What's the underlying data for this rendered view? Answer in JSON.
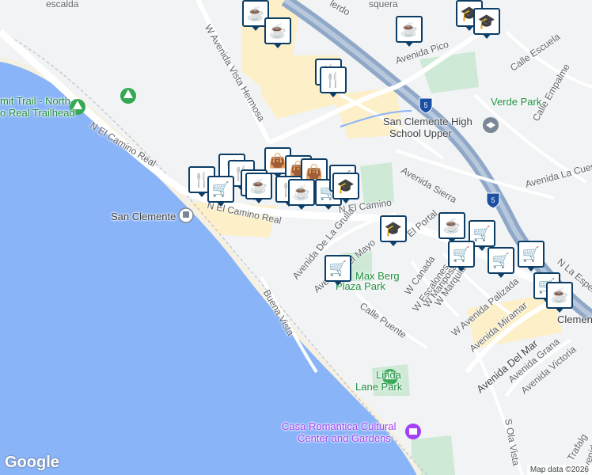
{
  "map": {
    "colors": {
      "land": "#f1f3f4",
      "water": "#8ab4f8",
      "park": "#ceead6",
      "highway": "#8fa8c8",
      "road": "#ffffff",
      "commercial": "#fdf0c8"
    },
    "labels": [
      {
        "id": "n-el-camino-real-1",
        "text": "N El Camino Real",
        "kind": "road"
      },
      {
        "id": "n-el-camino-real-2",
        "text": "N El Camino Real",
        "kind": "road"
      },
      {
        "id": "n-el-camino-real-3",
        "text": "N El Camino",
        "kind": "road"
      },
      {
        "id": "w-avenida-vista-hermosa",
        "text": "W Avenida Vista Hermosa",
        "kind": "road"
      },
      {
        "id": "avenida-pico",
        "text": "Avenida Pico",
        "kind": "road"
      },
      {
        "id": "calle-escuela",
        "text": "Calle Escuela",
        "kind": "road"
      },
      {
        "id": "calle-empalme",
        "text": "Calle Empalme",
        "kind": "road"
      },
      {
        "id": "avenida-sierra",
        "text": "Avenida Sierra",
        "kind": "road"
      },
      {
        "id": "avenida-la-cuesta",
        "text": "Avenida La Cuesta",
        "kind": "road"
      },
      {
        "id": "avenida-de-la-grulla",
        "text": "Avenida De La Grulla",
        "kind": "road"
      },
      {
        "id": "el-portal",
        "text": "El Portal",
        "kind": "road"
      },
      {
        "id": "avenida-del-mayo",
        "text": "Avenida Del Mayo",
        "kind": "road"
      },
      {
        "id": "w-canada",
        "text": "W Canada",
        "kind": "road"
      },
      {
        "id": "w-escalones",
        "text": "W Escalones",
        "kind": "road"
      },
      {
        "id": "w-mariposa",
        "text": "W Mariposa",
        "kind": "road"
      },
      {
        "id": "w-marquita",
        "text": "W Marquita",
        "kind": "road"
      },
      {
        "id": "w-avenida-palizada",
        "text": "W Avenida Palizada",
        "kind": "road"
      },
      {
        "id": "avenida-miramar",
        "text": "Avenida Miramar",
        "kind": "road"
      },
      {
        "id": "n-la-esperanza",
        "text": "N La Espera",
        "kind": "road"
      },
      {
        "id": "calle-puente",
        "text": "Calle Puente",
        "kind": "road"
      },
      {
        "id": "buena-vista",
        "text": "Buena Vista",
        "kind": "road"
      },
      {
        "id": "avenida-del-mar",
        "text": "Avenida Del Mar",
        "kind": "road"
      },
      {
        "id": "avenida-granada",
        "text": "Avenida Grana",
        "kind": "road"
      },
      {
        "id": "avenida-victoria",
        "text": "Avenida Victoria",
        "kind": "road"
      },
      {
        "id": "s-ola-vista",
        "text": "S Ola Vista",
        "kind": "road"
      },
      {
        "id": "trafalgar",
        "text": "Trafalg",
        "kind": "road"
      },
      {
        "id": "avenida-la-paz",
        "text": "Avenida La",
        "kind": "road"
      },
      {
        "id": "w-escalda",
        "text": "escalda",
        "kind": "road"
      },
      {
        "id": "esquera",
        "text": "squera",
        "kind": "road"
      },
      {
        "id": "top-calle",
        "text": "lerdo",
        "kind": "road"
      },
      {
        "id": "san-clemente-station",
        "text": "San Clemente",
        "kind": "poi"
      },
      {
        "id": "san-clemente-high",
        "text": "San Clemente High",
        "kind": "poi"
      },
      {
        "id": "san-clemente-high-2",
        "text": "School Upper",
        "kind": "poi"
      },
      {
        "id": "verde-park",
        "text": "Verde Park",
        "kind": "park"
      },
      {
        "id": "max-berg",
        "text": "Max Berg",
        "kind": "park"
      },
      {
        "id": "max-berg-2",
        "text": "Plaza Park",
        "kind": "park"
      },
      {
        "id": "linda-lane",
        "text": "Linda",
        "kind": "park"
      },
      {
        "id": "linda-lane-2",
        "text": "Lane Park",
        "kind": "park"
      },
      {
        "id": "casa-romantica",
        "text": "Casa Romantica Cultural",
        "kind": "culture"
      },
      {
        "id": "casa-romantica-2",
        "text": "Center and Gardens",
        "kind": "culture"
      },
      {
        "id": "trail-1",
        "text": "mit Trail - North",
        "kind": "park"
      },
      {
        "id": "trail-2",
        "text": "o Real Trailhead",
        "kind": "park"
      },
      {
        "id": "san-clemente-city",
        "text": "Clemente",
        "kind": "big"
      },
      {
        "id": "interstate-5",
        "text": "5",
        "kind": "shield"
      }
    ],
    "markers": [
      {
        "type": "cafe",
        "icon": "coffee-cup-icon"
      },
      {
        "type": "cafe",
        "icon": "coffee-cup-icon"
      },
      {
        "type": "cafe",
        "icon": "coffee-cup-icon"
      },
      {
        "type": "school",
        "icon": "graduation-cap-icon"
      },
      {
        "type": "school",
        "icon": "graduation-cap-icon"
      },
      {
        "type": "restaurant",
        "icon": "fork-knife-icon"
      },
      {
        "type": "restaurant",
        "icon": "fork-knife-icon"
      },
      {
        "type": "restaurant",
        "icon": "fork-knife-icon"
      },
      {
        "type": "restaurant",
        "icon": "fork-knife-icon"
      },
      {
        "type": "shopping",
        "icon": "shopping-bag-icon"
      },
      {
        "type": "shopping",
        "icon": "shopping-bag-icon"
      },
      {
        "type": "shopping",
        "icon": "shopping-bag-icon"
      },
      {
        "type": "cafe",
        "icon": "coffee-cup-icon"
      },
      {
        "type": "cafe",
        "icon": "coffee-cup-icon"
      },
      {
        "type": "restaurant",
        "icon": "fork-knife-icon"
      },
      {
        "type": "restaurant",
        "icon": "fork-knife-icon"
      },
      {
        "type": "cafe",
        "icon": "coffee-cup-icon"
      },
      {
        "type": "grocery",
        "icon": "shopping-cart-icon"
      },
      {
        "type": "grocery",
        "icon": "shopping-cart-icon"
      },
      {
        "type": "grocery",
        "icon": "shopping-cart-icon"
      },
      {
        "type": "school",
        "icon": "graduation-cap-icon"
      },
      {
        "type": "school",
        "icon": "graduation-cap-icon"
      },
      {
        "type": "cafe",
        "icon": "coffee-cup-icon"
      },
      {
        "type": "grocery",
        "icon": "shopping-cart-icon"
      },
      {
        "type": "grocery",
        "icon": "shopping-cart-icon"
      },
      {
        "type": "grocery",
        "icon": "shopping-cart-icon"
      },
      {
        "type": "grocery",
        "icon": "shopping-cart-icon"
      },
      {
        "type": "grocery",
        "icon": "shopping-cart-icon"
      },
      {
        "type": "grocery",
        "icon": "shopping-cart-icon"
      },
      {
        "type": "cafe",
        "icon": "coffee-cup-icon"
      }
    ],
    "branding": {
      "logo": "Google",
      "attribution": "Map data ©2026"
    }
  }
}
